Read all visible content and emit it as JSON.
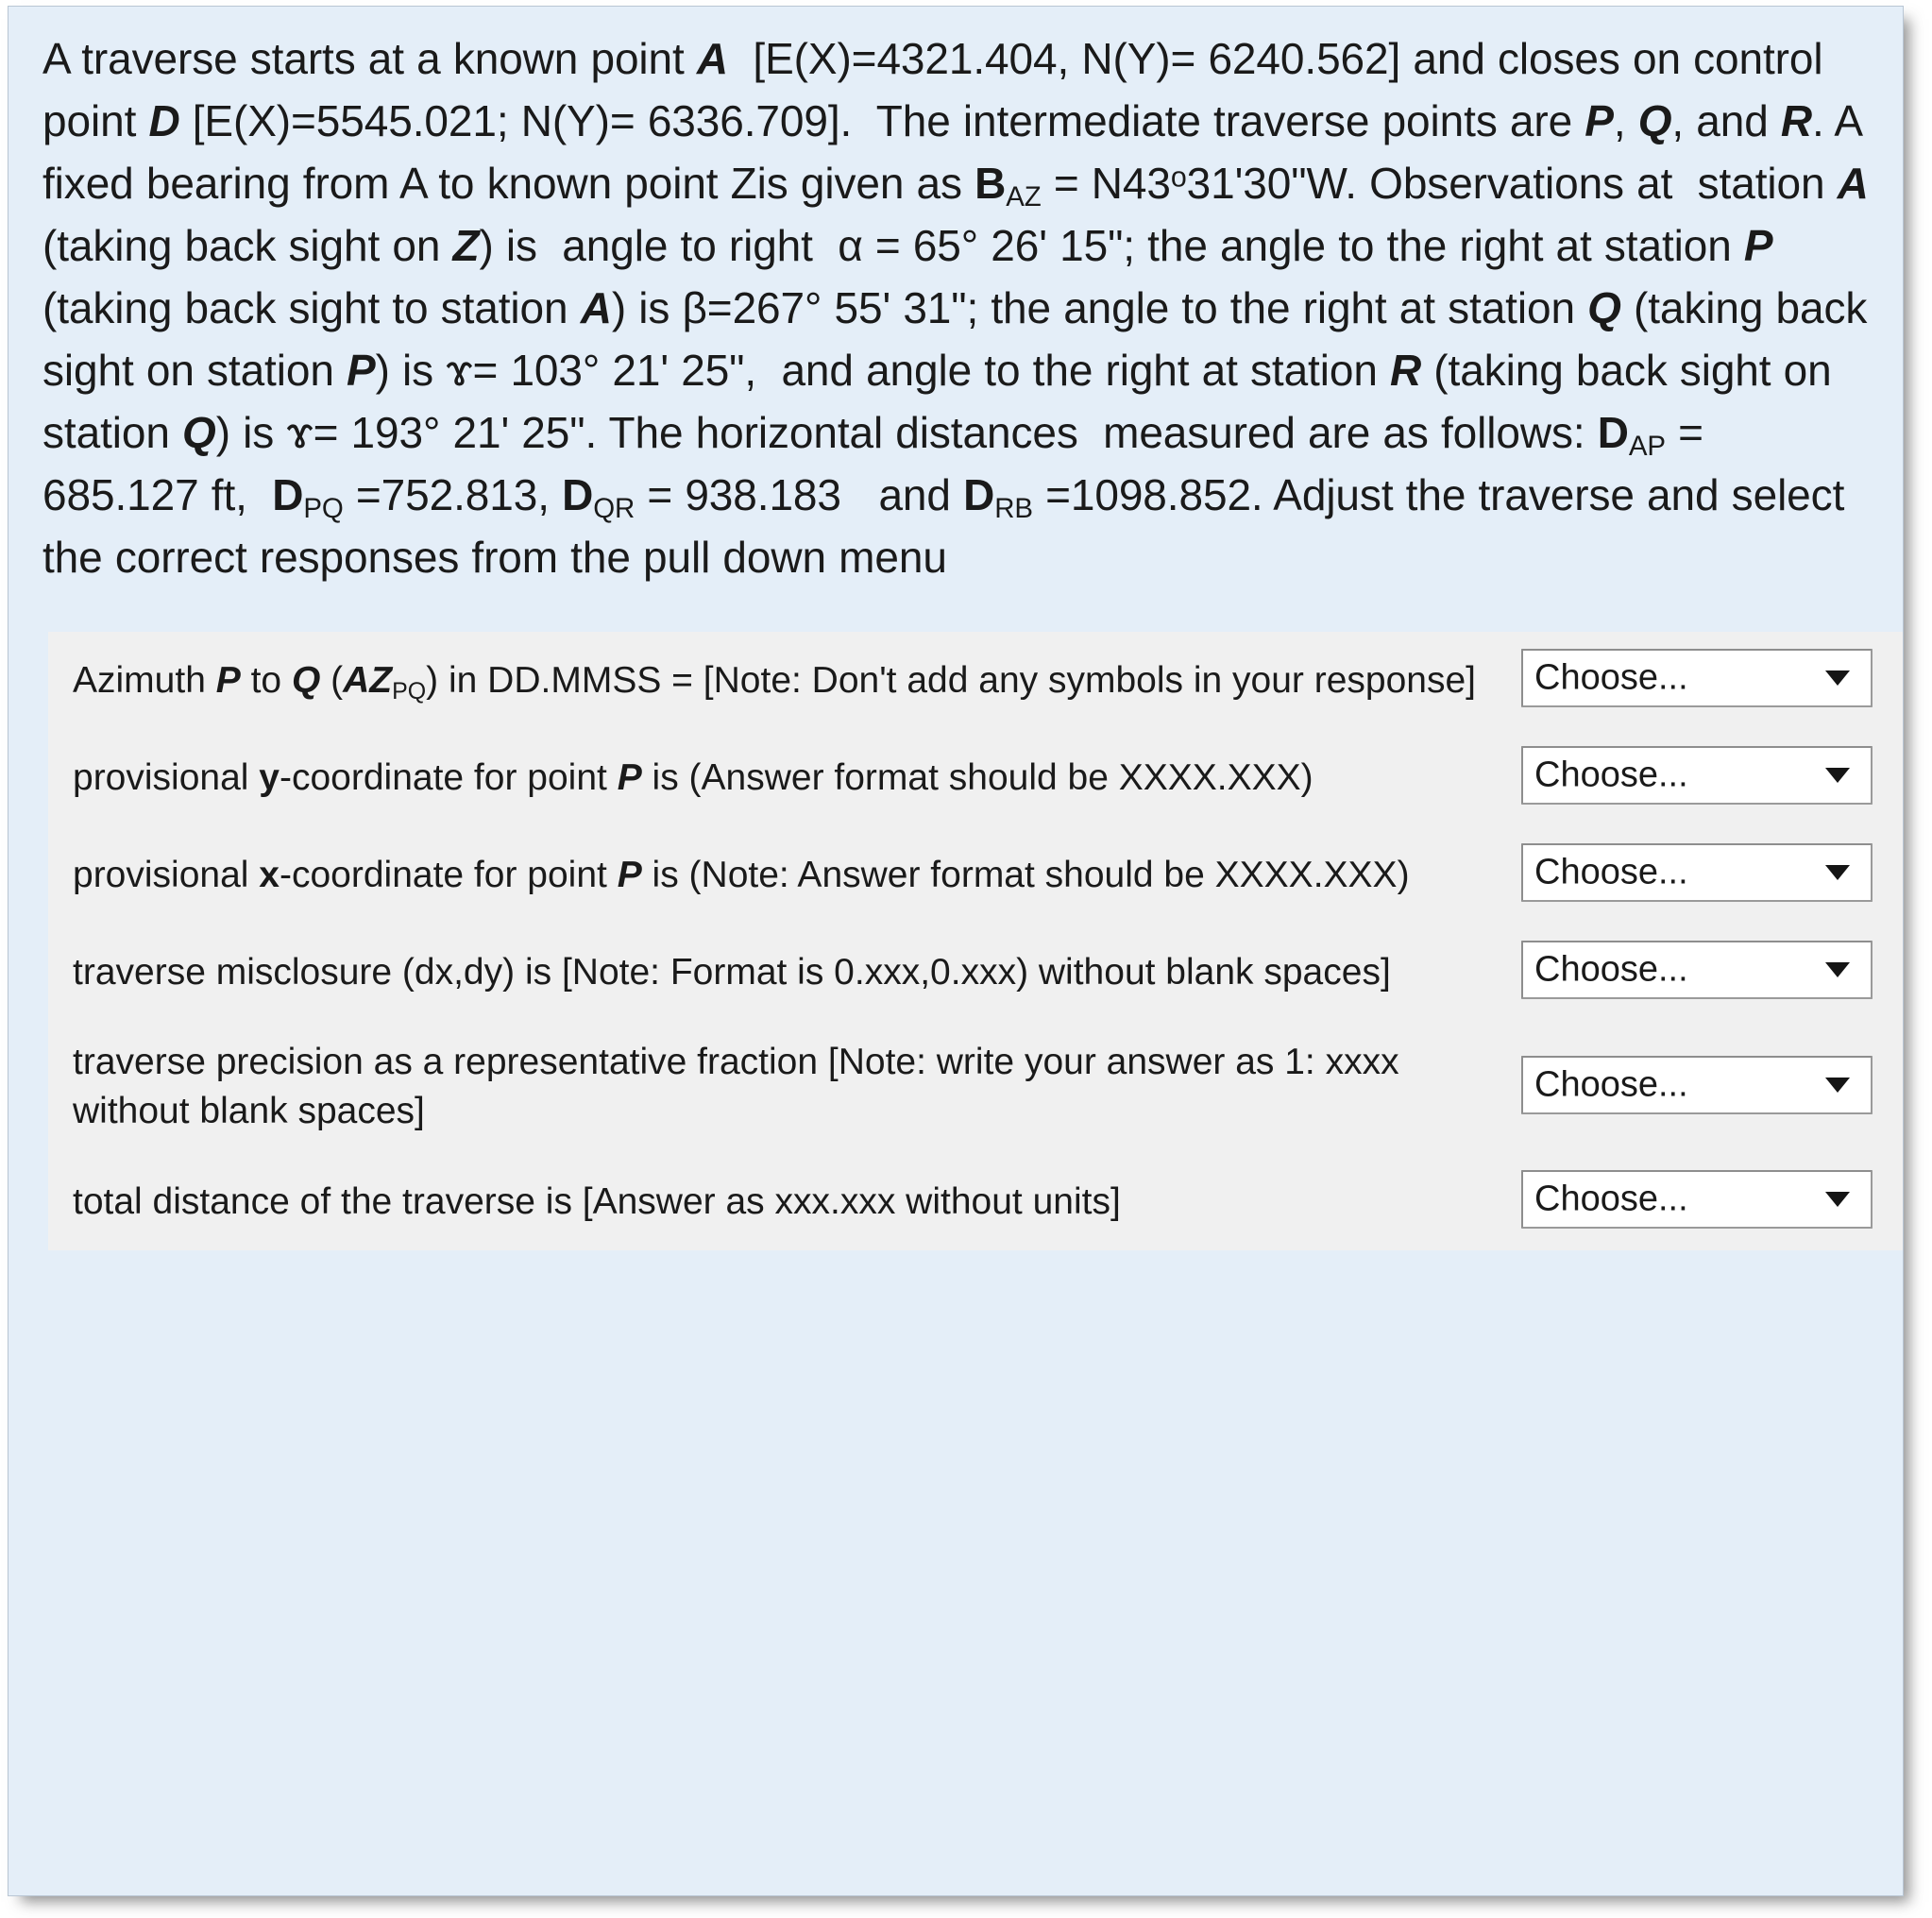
{
  "question": {
    "stem_lines": [
      "A traverse starts at a known point A  [E(X)=4321.404, N(Y)= 6240.562] and",
      "closes on control point D [E(X)=5545.021; N(Y)= 6336.709].  The intermediate",
      "traverse points are P, Q, and R. A fixed bearing from A to known point Zis",
      "given as BAZ = N43º31'30\"W. Observations at  station A (taking back sight on",
      "Z) is  angle to right  α = 65° 26' 15\"; the angle to the right at station P",
      "(taking back sight to station A) is β=267° 55' 31\"; the angle to the right at station",
      "Q (taking back sight on station P) is ɤ= 103° 21' 25\",  and angle to the right at",
      "station R (taking back sight on station Q) is ɤ= 193° 21' 25\". The horizontal",
      "distances  measured are as follows: DAP = 685.127 ft,  DPQ =752.813, DQR =",
      "938.183   and DRB =1098.852. Adjust the traverse and  select  the correct",
      "responses from the pull down menu"
    ],
    "known_point_a": {
      "label": "A",
      "E_X": "4321.404",
      "N_Y": "6240.562"
    },
    "control_point_d": {
      "label": "D",
      "E_X": "5545.021",
      "N_Y": "6336.709"
    },
    "intermediate_points": [
      "P",
      "Q",
      "R"
    ],
    "fixed_bearing": {
      "symbol": "B",
      "subscript": "AZ",
      "value": "N43º31'30\"W"
    },
    "angles": [
      {
        "station": "A",
        "backsight": "Z",
        "symbol": "α",
        "value": "65° 26' 15\""
      },
      {
        "station": "P",
        "backsight": "A",
        "symbol": "β",
        "value": "267° 55' 31\""
      },
      {
        "station": "Q",
        "backsight": "P",
        "symbol": "ɤ",
        "value": "103° 21' 25\""
      },
      {
        "station": "R",
        "backsight": "Q",
        "symbol": "ɤ",
        "value": "193° 21' 25\""
      }
    ],
    "distances": [
      {
        "symbol": "D",
        "subscript": "AP",
        "value": "685.127",
        "units": "ft"
      },
      {
        "symbol": "D",
        "subscript": "PQ",
        "value": "752.813",
        "units": ""
      },
      {
        "symbol": "D",
        "subscript": "QR",
        "value": "938.183",
        "units": ""
      },
      {
        "symbol": "D",
        "subscript": "RB",
        "value": "1098.852",
        "units": ""
      }
    ],
    "instruction": "Adjust the traverse and  select  the correct responses from the pull down menu"
  },
  "rows": [
    {
      "text_a": "Azimuth ",
      "p": "P",
      "text_b": " to ",
      "q": "Q",
      "text_c": " (",
      "az": "AZ",
      "az_sub": "PQ",
      "text_d": ") in DD.MMSS =   [Note: Don't add any symbols in your response]",
      "select": {
        "value": "Choose...",
        "arrow": "chevron-down-icon"
      }
    },
    {
      "text_a": "provisional ",
      "bold": "y",
      "text_b": "-coordinate for point ",
      "p": "P",
      "text_c": " is (Answer format should be XXXX.XXX)",
      "select": {
        "value": "Choose...",
        "arrow": "chevron-down-icon"
      }
    },
    {
      "text_a": "provisional ",
      "bold": "x",
      "text_b": "-coordinate for point ",
      "p": "P",
      "text_c": " is (Note: Answer format should be XXXX.XXX)",
      "select": {
        "value": "Choose...",
        "arrow": "chevron-down-icon"
      }
    },
    {
      "text_a": "traverse misclosure (dx,dy) is [Note: Format is 0.xxx,0.xxx) without blank spaces]",
      "select": {
        "value": "Choose...",
        "arrow": "chevron-down-icon"
      }
    },
    {
      "text_a": "traverse precision as a representative fraction [Note: write your answer as 1: xxxx without blank spaces]",
      "select": {
        "value": "Choose...",
        "arrow": "chevron-down-icon"
      }
    },
    {
      "text_a": "total distance of the traverse is [Answer as xxx.xxx without units]",
      "select": {
        "value": "Choose...",
        "arrow": "chevron-down-icon"
      }
    }
  ],
  "colors": {
    "panel_background": "#e4eef8",
    "answer_background": "#f0f0f0",
    "text": "#1a1a1a",
    "border": "#b9c6d4",
    "select_border": "#9a9a9a"
  }
}
